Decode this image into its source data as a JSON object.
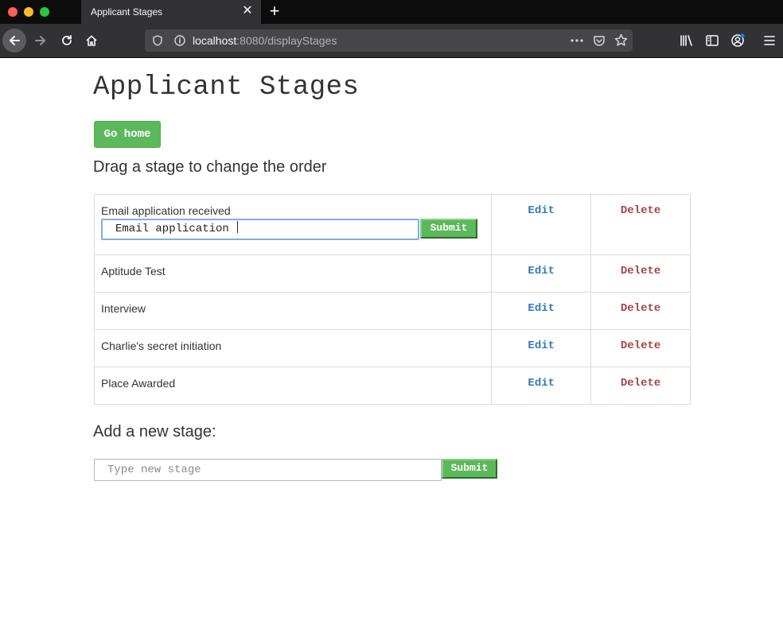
{
  "browser": {
    "tab_title": "Applicant Stages",
    "url_host": "localhost",
    "url_path": ":8080/displayStages"
  },
  "page": {
    "title": "Applicant Stages",
    "home_button": "Go home",
    "drag_hint": "Drag a stage to change the order",
    "edit_label": "Edit",
    "delete_label": "Delete",
    "stages": [
      {
        "name": "Email application received"
      },
      {
        "name": "Aptitude Test"
      },
      {
        "name": "Interview"
      },
      {
        "name": "Charlie's secret initiation"
      },
      {
        "name": "Place Awarded"
      }
    ],
    "edit_form": {
      "value": "Email application ",
      "submit_label": "Submit"
    },
    "add_title": "Add a new stage:",
    "add_form": {
      "placeholder": "Type new stage",
      "submit_label": "Submit"
    }
  },
  "colors": {
    "accent_green": "#5cb85c",
    "edit_blue": "#337ab7",
    "delete_red": "#a94442"
  }
}
